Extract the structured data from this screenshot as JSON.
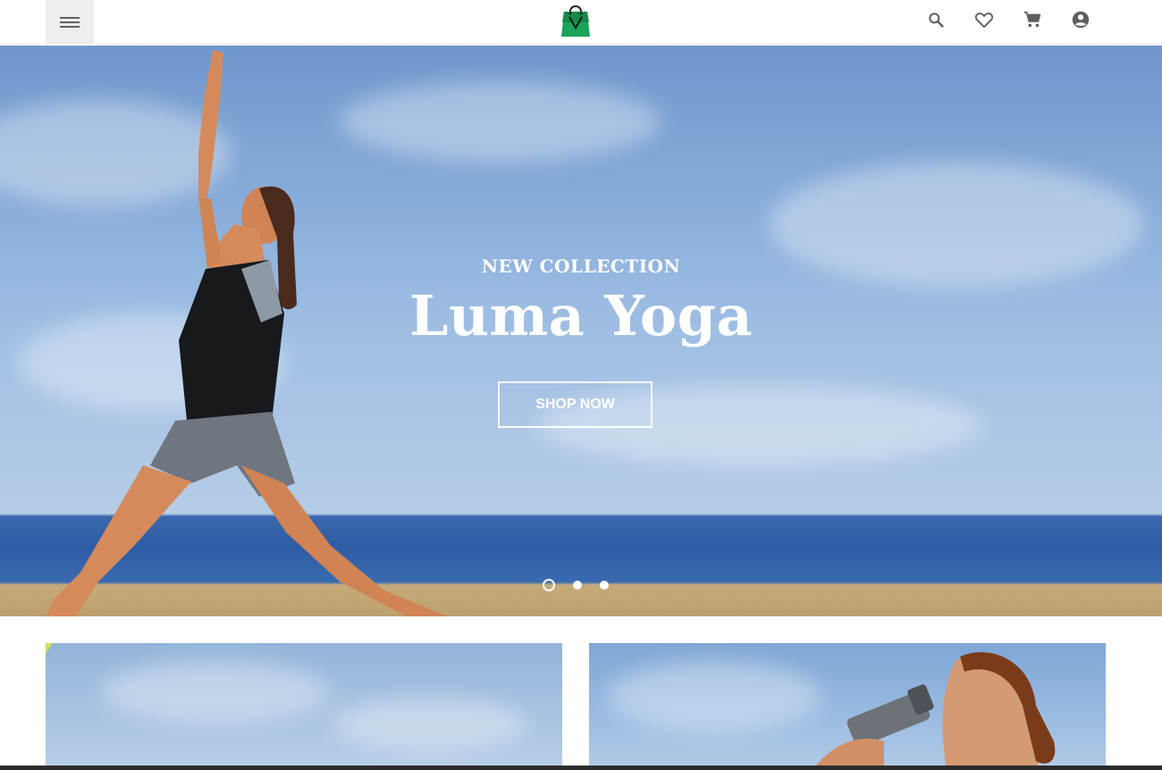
{
  "header": {
    "menu_icon": "hamburger-menu-icon",
    "logo_icon": "shopping-bag-logo-icon",
    "actions": [
      {
        "name": "search-icon"
      },
      {
        "name": "heart-icon"
      },
      {
        "name": "cart-icon"
      },
      {
        "name": "account-icon"
      }
    ]
  },
  "hero": {
    "eyebrow": "NEW COLLECTION",
    "headline": "Luma Yoga",
    "cta_label": "SHOP NOW",
    "slides_count": 3,
    "active_slide": 1
  },
  "colors": {
    "logo_green": "#1aa35a",
    "icon_gray": "#5f5f5f",
    "menu_bg": "#eeeeee"
  }
}
